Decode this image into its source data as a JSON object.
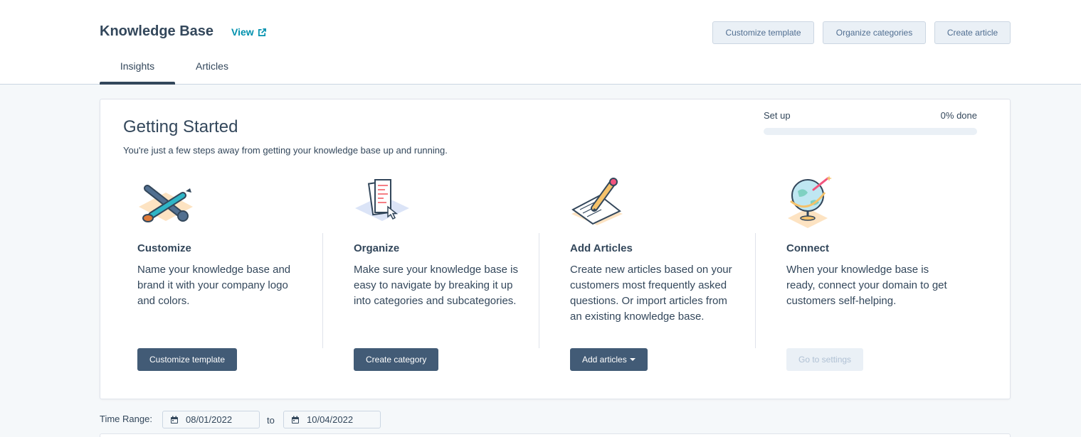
{
  "header": {
    "title": "Knowledge Base",
    "view_label": "View",
    "buttons": {
      "customize_template": "Customize template",
      "organize_categories": "Organize categories",
      "create_article": "Create article"
    },
    "tabs": [
      {
        "label": "Insights",
        "active": true
      },
      {
        "label": "Articles",
        "active": false
      }
    ]
  },
  "getting_started": {
    "title": "Getting Started",
    "subtitle": "You're just a few steps away from getting your knowledge base up and running.",
    "setup_label": "Set up",
    "progress_text": "0% done",
    "progress_fraction": 0,
    "steps": [
      {
        "icon": "wrench-brush-icon",
        "title": "Customize",
        "description": "Name your knowledge base and brand it with your company logo and colors.",
        "button": "Customize template",
        "disabled": false
      },
      {
        "icon": "documents-cursor-icon",
        "title": "Organize",
        "description": "Make sure your knowledge base is easy to navigate by breaking it up into categories and subcategories.",
        "button": "Create category",
        "disabled": false
      },
      {
        "icon": "pencil-paper-icon",
        "title": "Add Articles",
        "description": "Create new articles based on your customers most frequently asked questions. Or import articles from an existing knowledge base.",
        "button": "Add articles",
        "disabled": false
      },
      {
        "icon": "globe-icon",
        "title": "Connect",
        "description": "When your knowledge base is ready, connect your domain to get customers self-helping.",
        "button": "Go to settings",
        "disabled": true
      }
    ]
  },
  "time_range": {
    "label": "Time Range:",
    "start": "08/01/2022",
    "to_label": "to",
    "end": "10/04/2022"
  },
  "colors": {
    "primary_text": "#33475b",
    "link": "#0091ae",
    "dark_button": "#425b76",
    "light_button": "#eaf0f6"
  }
}
